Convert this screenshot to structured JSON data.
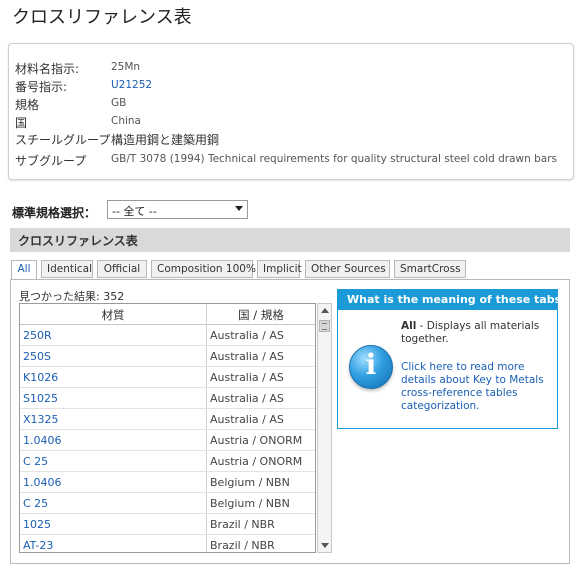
{
  "page_title": "クロスリファレンス表",
  "info": {
    "rows": [
      {
        "label": "材料名指示:",
        "value": "25Mn"
      },
      {
        "label": "番号指示:",
        "value": "U21252"
      },
      {
        "label": "規格",
        "value": "GB"
      },
      {
        "label": "国",
        "value": "China"
      },
      {
        "label": "スチールグループ",
        "value": "構造用鋼と建築用鋼"
      },
      {
        "label": "サブグループ",
        "value": "GB/T 3078 (1994) Technical requirements for quality structural steel cold drawn bars"
      }
    ]
  },
  "standard_select": {
    "label": "標準規格選択：",
    "value": "-- 全て --"
  },
  "section_title": "クロスリファレンス表",
  "tabs": [
    "All",
    "Identical",
    "Official",
    "Composition 100%",
    "Implicit",
    "Other Sources",
    "SmartCross"
  ],
  "results": {
    "label": "見つかった結果: 352",
    "headers": [
      "材質",
      "国 / 規格"
    ],
    "rows": [
      {
        "material": "250R",
        "country": "Australia / AS"
      },
      {
        "material": "250S",
        "country": "Australia / AS"
      },
      {
        "material": "K1026",
        "country": "Australia / AS"
      },
      {
        "material": "S1025",
        "country": "Australia / AS"
      },
      {
        "material": "X1325",
        "country": "Australia / AS"
      },
      {
        "material": "1.0406",
        "country": "Austria / ONORM"
      },
      {
        "material": "C 25",
        "country": "Austria / ONORM"
      },
      {
        "material": "1.0406",
        "country": "Belgium / NBN"
      },
      {
        "material": "C 25",
        "country": "Belgium / NBN"
      },
      {
        "material": "1025",
        "country": "Brazil / NBR"
      },
      {
        "material": "AT-23",
        "country": "Brazil / NBR"
      }
    ]
  },
  "help": {
    "title": "What is the meaning of these tabs?",
    "all_bold": "All",
    "all_text": " - Displays all materials together.",
    "link_text": "Click here to read more details about Key to Metals cross-reference tables categorization.",
    "icon": "info-icon"
  },
  "colors": {
    "link": "#1a5fb4",
    "help_accent": "#1a9bd7",
    "section_bar": "#d9d9d9"
  }
}
